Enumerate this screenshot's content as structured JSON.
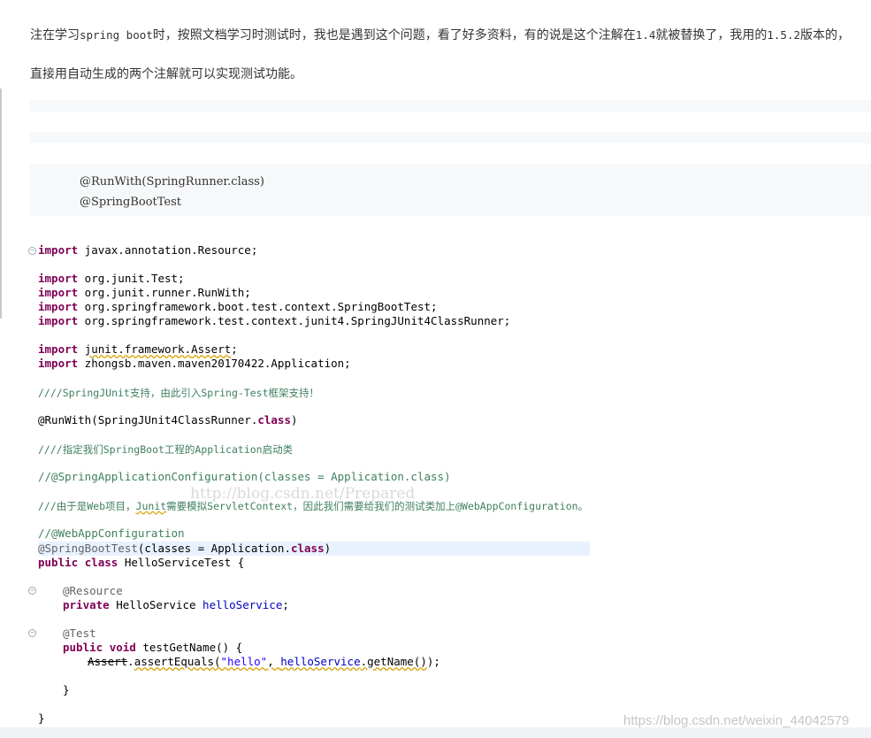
{
  "paragraphs": {
    "p1_a": "注在学习",
    "p1_b": "spring boot",
    "p1_c": "时，按照文档学习时测试时，我也是遇到这个问题，看了好多资料，有的说是这个注解在",
    "p1_d": "1.4",
    "p1_e": "就被替换了，我用的",
    "p1_f": "1.5.2",
    "p1_g": "版本的，",
    "p2": "直接用自动生成的两个注解就可以实现测试功能。"
  },
  "code_block": {
    "line1": "@RunWith(SpringRunner.class)",
    "line2": "@SpringBootTest"
  },
  "eclipse_code": {
    "l1_kw": "import",
    "l1_rest": " javax.annotation.Resource;",
    "l2_kw": "import",
    "l2_rest": " org.junit.Test;",
    "l3_kw": "import",
    "l3_rest": " org.junit.runner.RunWith;",
    "l4_kw": "import",
    "l4_rest": " org.springframework.boot.test.context.SpringBootTest;",
    "l5_kw": "import",
    "l5_rest": " org.springframework.test.context.junit4.SpringJUnit4ClassRunner;",
    "l6_kw": "import",
    "l6_a": "junit.framework.",
    "l6_b": "Assert",
    "l6_c": ";",
    "l7_kw": "import",
    "l7_rest": " zhongsb.maven.maven20170422.Application;",
    "c1": "////SpringJUnit支持，由此引入Spring-Test框架支持！",
    "run_a": "@RunWith(SpringJUnit4ClassRunner.",
    "run_kw": "class",
    "run_b": ")",
    "c2": "////指定我们SpringBoot工程的Application启动类",
    "c3": "//@SpringApplicationConfiguration(classes = Application.class)",
    "c4_a": "///由于是Web项目，",
    "c4_b": "Junit",
    "c4_c": "需要模拟ServletContext，因此我们需要给我们的测试类加上@WebAppConfiguration。",
    "c5": "//@WebAppConfiguration",
    "sbt_a": "@SpringBootTest",
    "sbt_b": "(classes = Application.",
    "sbt_kw": "class",
    "sbt_c": ")",
    "cls_kw1": "public",
    "cls_kw2": "class",
    "cls_rest": " HelloServiceTest {",
    "res_ann": "@Resource",
    "priv_kw": "private",
    "priv_type": " HelloService ",
    "priv_field": "helloService",
    "priv_end": ";",
    "test_ann": "@Test",
    "m_kw1": "public",
    "m_kw2": "void",
    "m_rest": " testGetName() {",
    "a_cls": "Assert",
    "a_dot": ".",
    "a_meth": "assertEquals",
    "a_open": "(",
    "a_str": "\"hello\"",
    "a_comma": ", ",
    "a_field": "helloService",
    "a_call": ".getName()",
    "a_end": ");",
    "close_inner": "}",
    "close_outer": "}"
  },
  "watermarks": {
    "middle": "http://blog.csdn.net/Prepared",
    "bottom_right": "https://blog.csdn.net/weixin_44042579"
  }
}
